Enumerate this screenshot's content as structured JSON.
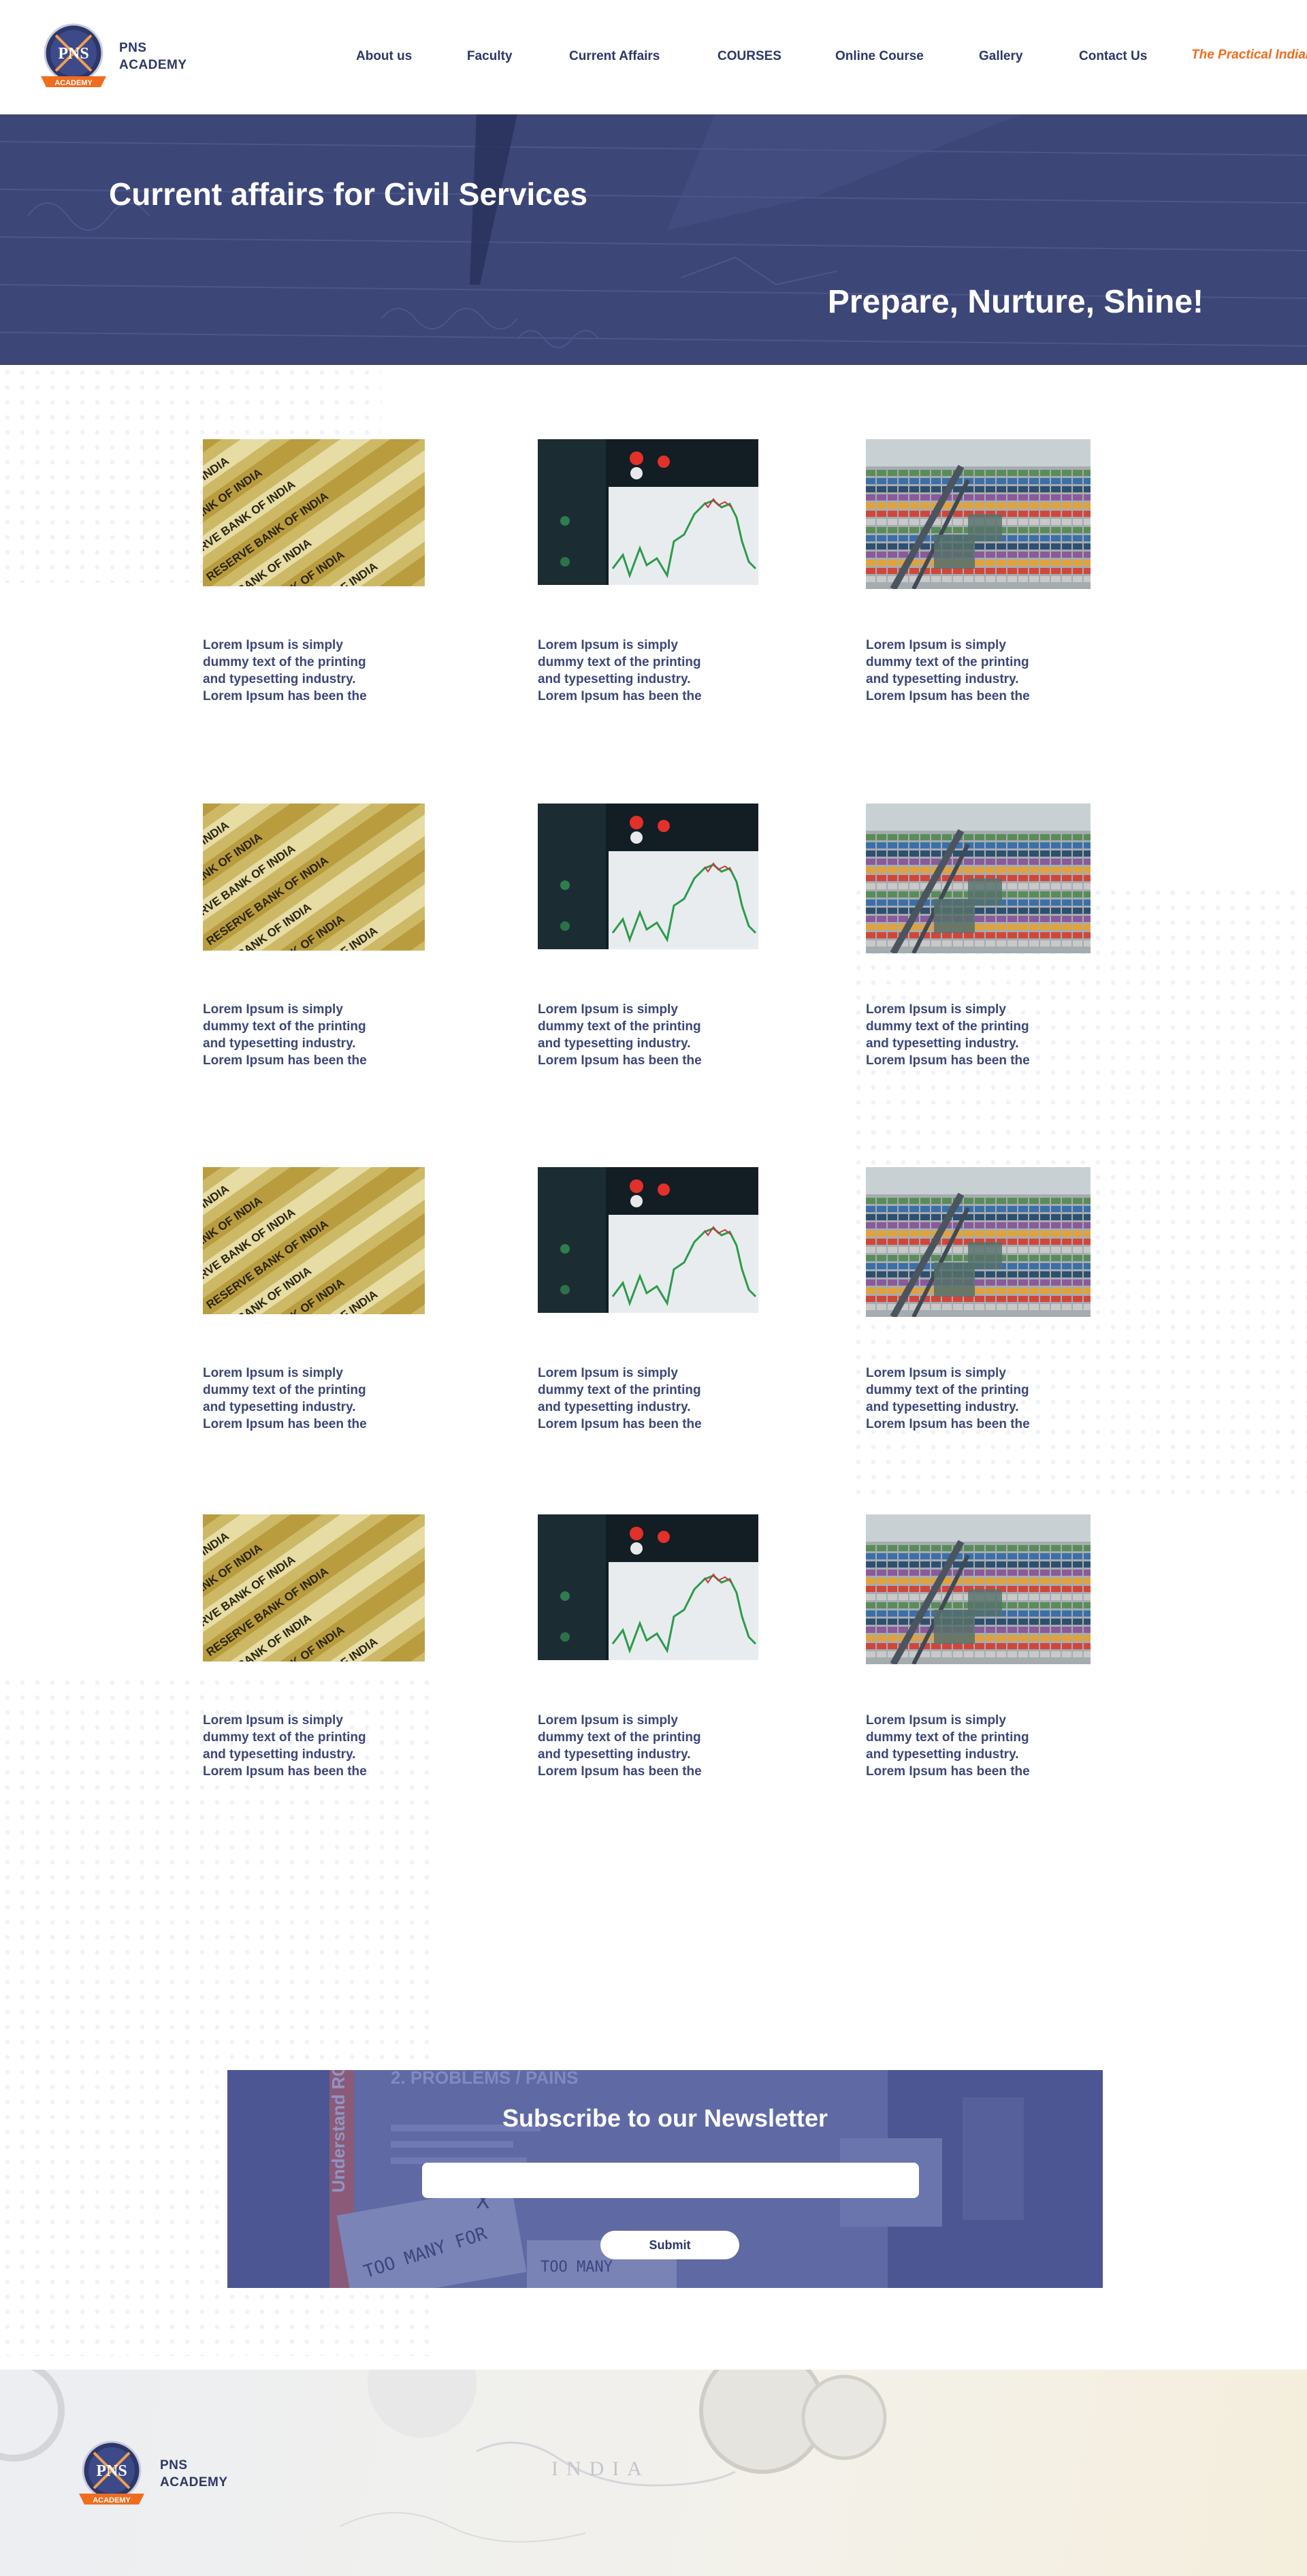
{
  "header": {
    "brand_line1": "PNS",
    "brand_line2": "ACADEMY",
    "logo_text": "PNS",
    "logo_ribbon": "ACADEMY",
    "nav": [
      "About us",
      "Faculty",
      "Current Affairs",
      "COURSES",
      "Online Course",
      "Gallery",
      "Contact Us"
    ],
    "cta_label": "The Practical Indian"
  },
  "hero": {
    "title": "Current affairs for Civil Services",
    "tagline": "Prepare, Nurture, Shine!"
  },
  "cards": {
    "excerpt_lines": [
      "Lorem Ipsum is simply",
      "dummy text of the printing",
      "and typesetting industry.",
      "Lorem Ipsum has been the"
    ],
    "rbi_image_text": "RESERVE BANK OF INDIA"
  },
  "newsletter": {
    "title": "Subscribe to our Newsletter",
    "input_value": "",
    "input_placeholder": "",
    "submit_label": "Submit",
    "bg_heading": "2. PROBLEMS / PAINS",
    "bg_side_text": "Understand RC",
    "bg_note_1": "TOO MANY FOR",
    "bg_note_2": "TOO MANY"
  },
  "footer": {
    "brand_line1": "PNS",
    "brand_line2": "ACADEMY",
    "map_label": "INDIA"
  },
  "colors": {
    "navy": "#2d3768",
    "hero_overlay": "#3c4677",
    "accent_orange": "#f06c1f",
    "white": "#ffffff"
  }
}
